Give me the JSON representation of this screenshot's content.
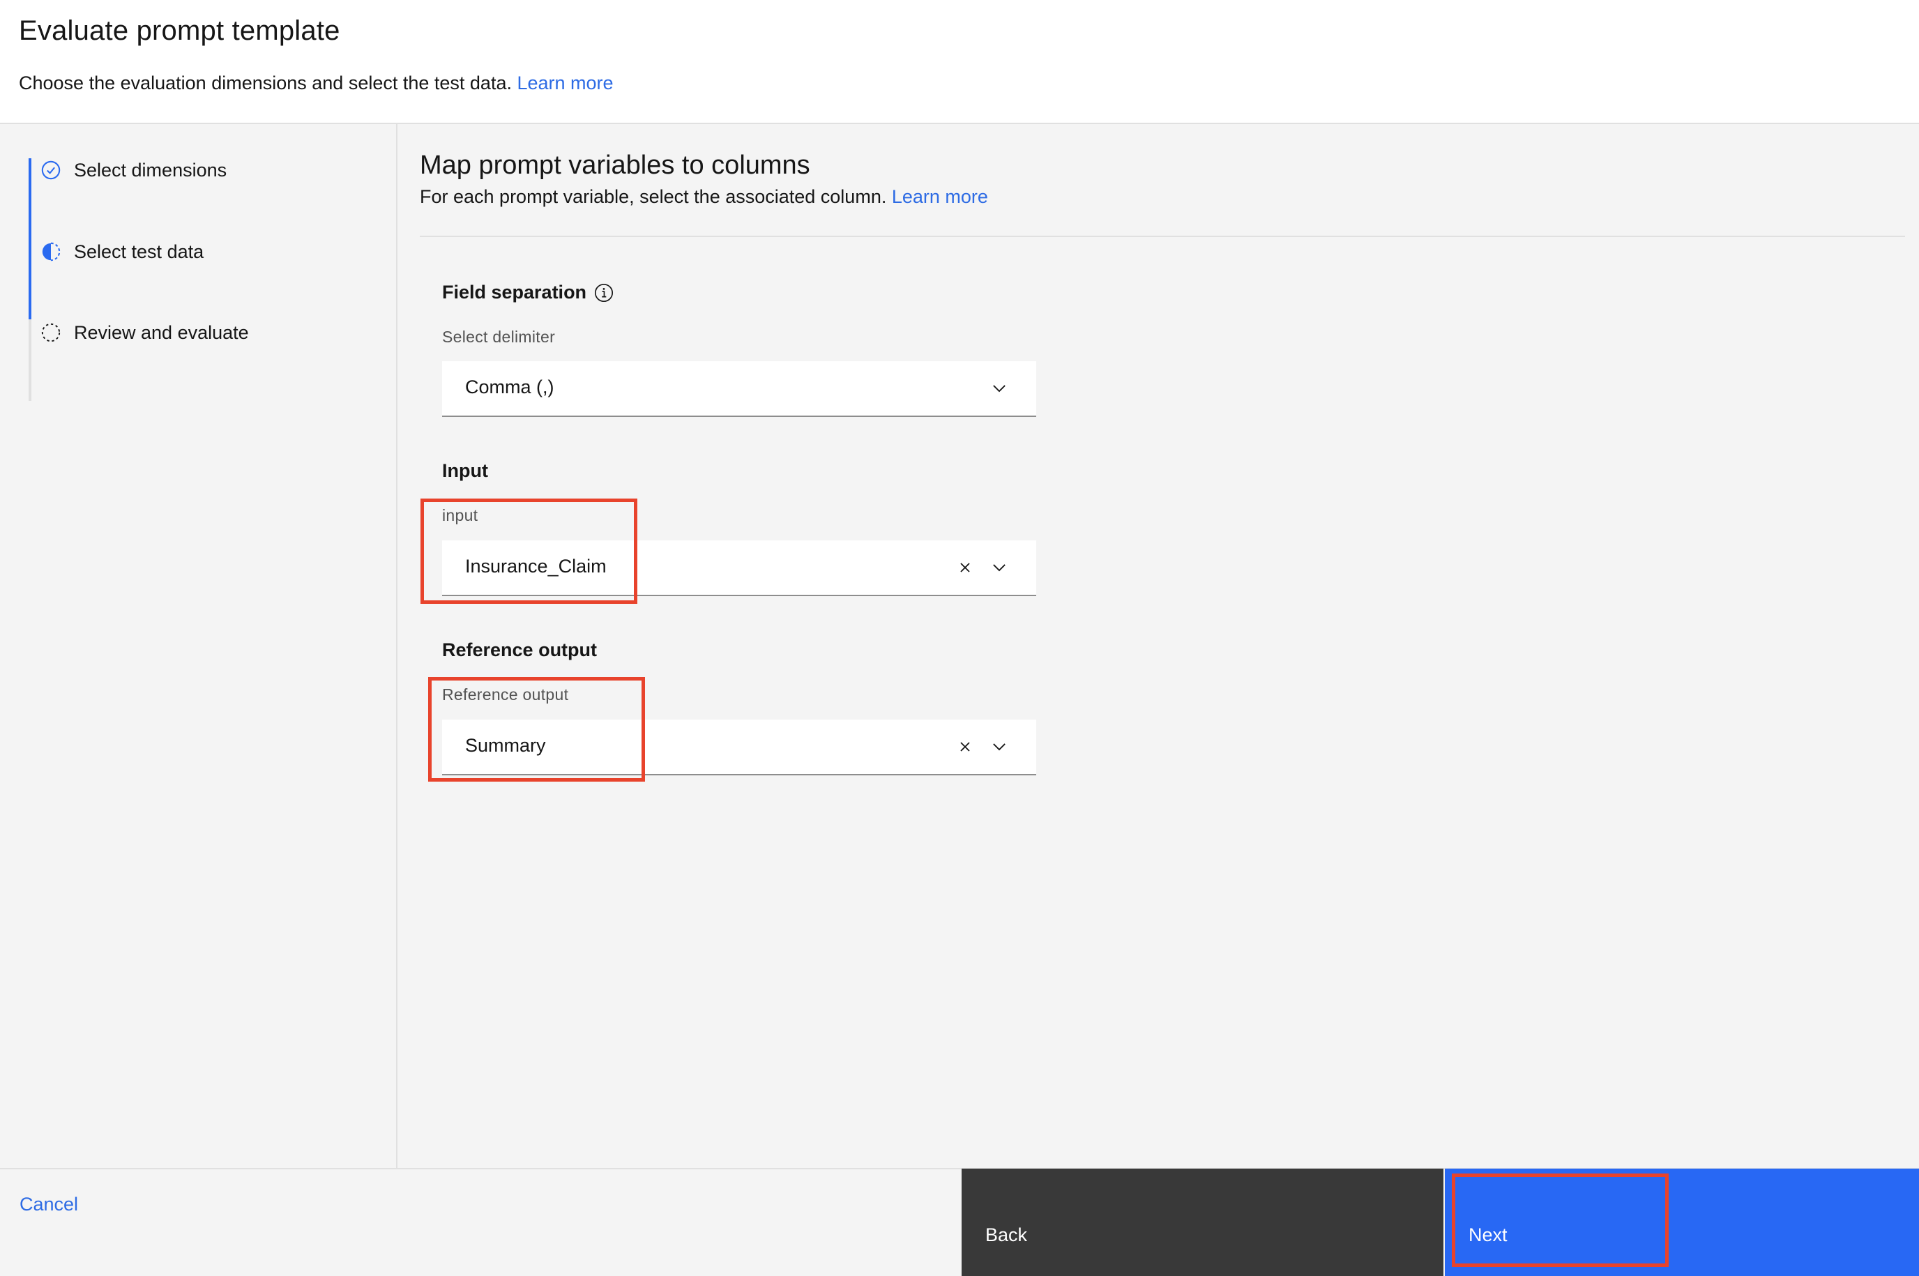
{
  "header": {
    "title": "Evaluate prompt template",
    "subtitle": "Choose the evaluation dimensions and select the test data.",
    "learn_more": "Learn more"
  },
  "steps": [
    {
      "label": "Select dimensions",
      "status": "complete",
      "icon": "checkmark-circle-icon"
    },
    {
      "label": "Select test data",
      "status": "current",
      "icon": "half-circle-icon"
    },
    {
      "label": "Review and evaluate",
      "status": "incomplete",
      "icon": "dashed-circle-icon"
    }
  ],
  "main": {
    "title": "Map prompt variables to columns",
    "subtitle": "For each prompt variable, select the associated column.",
    "learn_more": "Learn more",
    "field_separation": {
      "heading": "Field separation",
      "label": "Select delimiter",
      "value": "Comma (,)"
    },
    "input": {
      "heading": "Input",
      "label": "input",
      "value": "Insurance_Claim"
    },
    "reference_output": {
      "heading": "Reference output",
      "label": "Reference output",
      "value": "Summary"
    }
  },
  "footer": {
    "cancel": "Cancel",
    "back": "Back",
    "next": "Next"
  },
  "colors": {
    "accent": "#2868f4",
    "link": "#2d6be4",
    "highlight": "#e8432c",
    "back_button": "#393939"
  }
}
